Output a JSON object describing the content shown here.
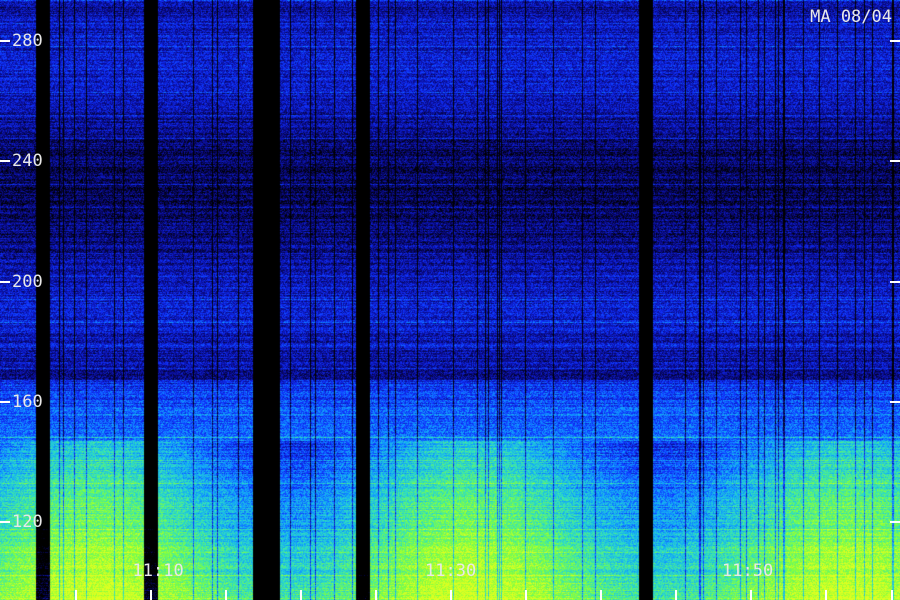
{
  "chart_data": {
    "type": "heatmap",
    "title": "",
    "tag": "MA 08/04",
    "ylabel": "",
    "xlabel": "",
    "ylim": [
      100,
      290
    ],
    "y_ticks": [
      280,
      240,
      200,
      160,
      120
    ],
    "x_tick_labels": [
      {
        "label": "11:10",
        "t": 0.175
      },
      {
        "label": "11:30",
        "t": 0.5
      },
      {
        "label": "11:50",
        "t": 0.83
      }
    ],
    "x_minor_ticks": [
      0.083,
      0.167,
      0.25,
      0.333,
      0.417,
      0.5,
      0.583,
      0.667,
      0.75,
      0.833,
      0.917,
      0.99
    ],
    "colormap": [
      "#000000",
      "#0a0a8a",
      "#1030ff",
      "#10a0ff",
      "#30e0c0",
      "#80ff40",
      "#e0ff20"
    ],
    "description": "Spectrogram showing intensity over frequency (y) and time (x); strongest power near 100-130, weakening upward, with dark vertical gaps."
  }
}
